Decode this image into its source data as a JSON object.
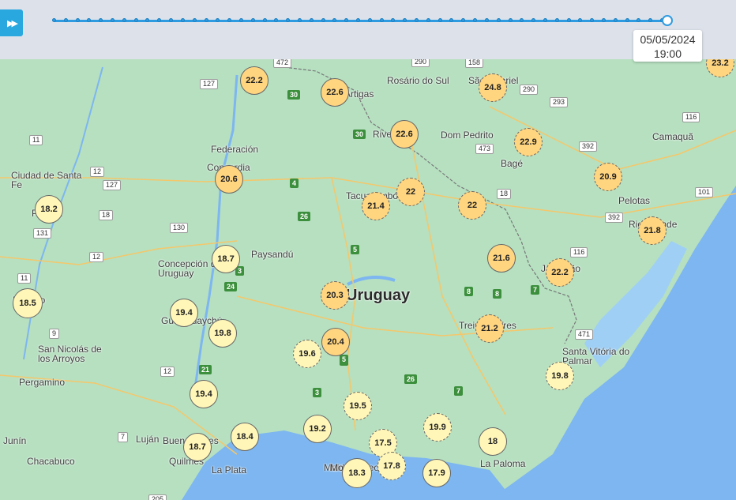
{
  "controls": {
    "play_icon": "fast-forward-icon",
    "play_glyph": "▶▶",
    "tick_count": 53
  },
  "timestamp": {
    "date": "05/05/2024",
    "time": "19:00"
  },
  "colors": {
    "accent": "#29a8e0",
    "warm": "#ffd580",
    "mild": "#fff6b8",
    "water": "#7db6f0",
    "land": "#b6e0c0"
  },
  "map": {
    "country_label": "Uruguay",
    "places": [
      {
        "name": "Rosário do Sul"
      },
      {
        "name": "São Gabriel"
      },
      {
        "name": "Dom Pedrito"
      },
      {
        "name": "Bagé"
      },
      {
        "name": "Camaquã"
      },
      {
        "name": "Pelotas"
      },
      {
        "name": "Rio Grande"
      },
      {
        "name": "Jaguarão"
      },
      {
        "name": "Santa Vitória do Palmar"
      },
      {
        "name": "La Paloma"
      },
      {
        "name": "Maldonado"
      },
      {
        "name": "Montevideo"
      },
      {
        "name": "Treinta y Tres"
      },
      {
        "name": "Tacuarembó"
      },
      {
        "name": "Rivera"
      },
      {
        "name": "Artigas"
      },
      {
        "name": "Federación"
      },
      {
        "name": "Concordia"
      },
      {
        "name": "Ciudad de Santa Fe"
      },
      {
        "name": "Paraná"
      },
      {
        "name": "Rosario"
      },
      {
        "name": "San Nicolás de los Arroyos"
      },
      {
        "name": "Pergamino"
      },
      {
        "name": "Junín"
      },
      {
        "name": "Chacabuco"
      },
      {
        "name": "Luján"
      },
      {
        "name": "Buenos Aires"
      },
      {
        "name": "Quilmes"
      },
      {
        "name": "La Plata"
      },
      {
        "name": "Concepción del Uruguay"
      },
      {
        "name": "Paysandú"
      },
      {
        "name": "Gualeguaychú"
      }
    ],
    "route_shields": [
      "472",
      "290",
      "158",
      "290",
      "127",
      "30",
      "30",
      "11",
      "12",
      "127",
      "18",
      "131",
      "130",
      "12",
      "11",
      "9",
      "12",
      "7",
      "205",
      "4",
      "26",
      "5",
      "5",
      "3",
      "24",
      "3",
      "21",
      "5",
      "3",
      "7",
      "8",
      "8",
      "26",
      "7",
      "18",
      "473",
      "293",
      "392",
      "392",
      "116",
      "101",
      "116",
      "471"
    ]
  },
  "stations": [
    {
      "value": "22.2",
      "tone": "o"
    },
    {
      "value": "22.6",
      "tone": "o"
    },
    {
      "value": "22.6",
      "tone": "o"
    },
    {
      "value": "24.8",
      "tone": "o"
    },
    {
      "value": "23.2",
      "tone": "o"
    },
    {
      "value": "22.9",
      "tone": "o"
    },
    {
      "value": "20.9",
      "tone": "o"
    },
    {
      "value": "20.6",
      "tone": "o"
    },
    {
      "value": "22",
      "tone": "o"
    },
    {
      "value": "21.4",
      "tone": "o"
    },
    {
      "value": "22",
      "tone": "o"
    },
    {
      "value": "18.2",
      "tone": "y"
    },
    {
      "value": "21.8",
      "tone": "o"
    },
    {
      "value": "18.7",
      "tone": "y"
    },
    {
      "value": "21.6",
      "tone": "o"
    },
    {
      "value": "22.2",
      "tone": "o"
    },
    {
      "value": "18.5",
      "tone": "y"
    },
    {
      "value": "20.3",
      "tone": "o"
    },
    {
      "value": "19.4",
      "tone": "y"
    },
    {
      "value": "19.8",
      "tone": "y"
    },
    {
      "value": "21.2",
      "tone": "o"
    },
    {
      "value": "20.4",
      "tone": "o"
    },
    {
      "value": "19.6",
      "tone": "y"
    },
    {
      "value": "19.8",
      "tone": "y"
    },
    {
      "value": "19.4",
      "tone": "y"
    },
    {
      "value": "19.5",
      "tone": "y"
    },
    {
      "value": "19.2",
      "tone": "y"
    },
    {
      "value": "18.4",
      "tone": "y"
    },
    {
      "value": "17.5",
      "tone": "y"
    },
    {
      "value": "19.9",
      "tone": "y"
    },
    {
      "value": "18",
      "tone": "y"
    },
    {
      "value": "18.7",
      "tone": "y"
    },
    {
      "value": "17.8",
      "tone": "y"
    },
    {
      "value": "18.3",
      "tone": "y"
    },
    {
      "value": "17.9",
      "tone": "y"
    }
  ]
}
